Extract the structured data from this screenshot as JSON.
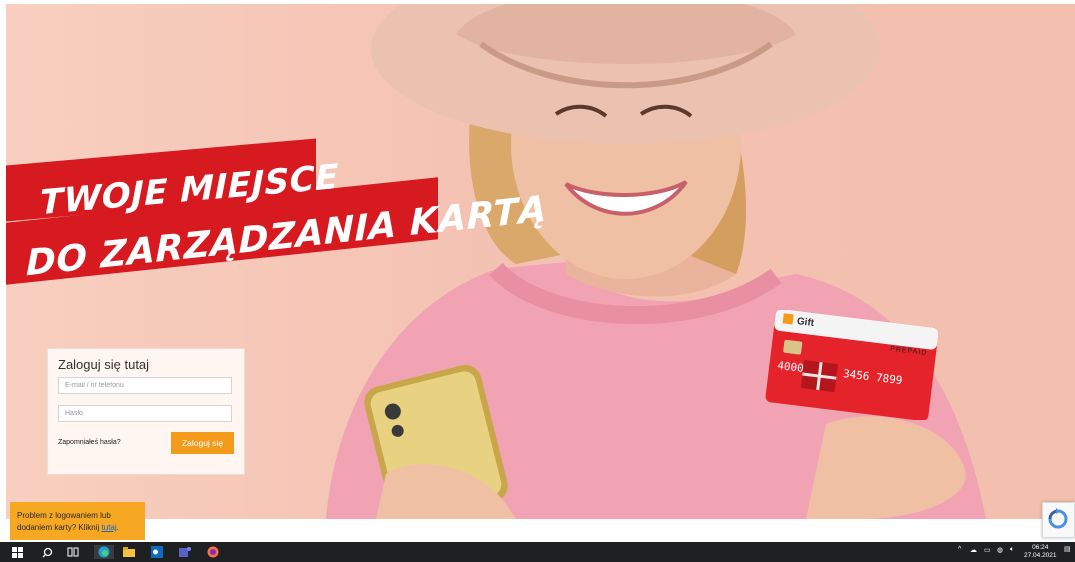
{
  "headline": {
    "line1": "TWOJE MIEJSCE",
    "line2": "DO ZARZĄDZANIA KARTĄ"
  },
  "login": {
    "title": "Zaloguj się tutaj",
    "email_placeholder": "E-mail / nr telefonu",
    "password_placeholder": "Hasło",
    "forgot_label": "Zapomniałeś hasła?",
    "submit_label": "Zaloguj się"
  },
  "card": {
    "brand": "Gift",
    "type": "PREPAID",
    "number": "4000 0012 3456 7899"
  },
  "help": {
    "text": "Problem z logowaniem lub dodaniem karty? Kliknij",
    "link_label": "tutaj"
  },
  "taskbar": {
    "time": "06:24",
    "date": "27.04.2021"
  },
  "colors": {
    "brand_red": "#d71920",
    "button_orange": "#f39a1b",
    "help_orange": "#f6a823",
    "background_peach": "#f4c2b2"
  },
  "icons": [
    "windows-start-icon",
    "search-icon",
    "task-view-icon",
    "edge-icon",
    "file-explorer-icon",
    "outlook-icon",
    "teams-icon",
    "firefox-icon",
    "recaptcha-icon"
  ]
}
